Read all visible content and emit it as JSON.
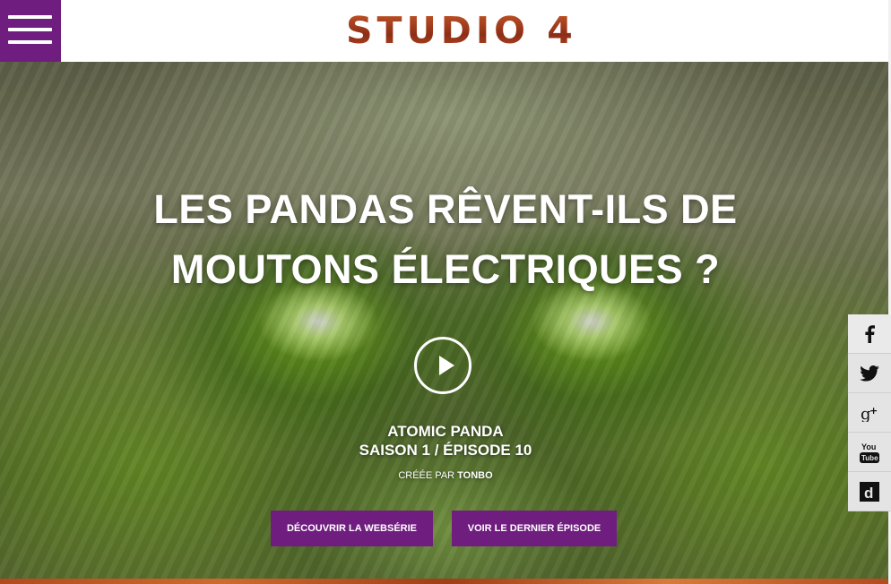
{
  "header": {
    "menu_label": "Menu",
    "logo_text": "STUDIO 4"
  },
  "hero": {
    "title_line1": "LES PANDAS RÊVENT-ILS DE",
    "title_line2": "MOUTONS ÉLECTRIQUES ?",
    "series_name": "ATOMIC PANDA",
    "season_episode": "SAISON 1 / ÉPISODE 10",
    "created_by_prefix": "CRÉÉE PAR",
    "created_by_name": "TONBO",
    "cta_primary": "DÉCOUVRIR LA WEBSÉRIE",
    "cta_secondary": "VOIR LE DERNIER ÉPISODE"
  },
  "social": {
    "items": [
      {
        "icon": "facebook-icon"
      },
      {
        "icon": "twitter-icon"
      },
      {
        "icon": "google-plus-icon"
      },
      {
        "icon": "youtube-icon"
      },
      {
        "icon": "dailymotion-icon"
      }
    ]
  },
  "colors": {
    "brand_purple": "#6f1e7f",
    "logo_rust": "#b0441f",
    "social_bg": "#e4e4e4"
  }
}
